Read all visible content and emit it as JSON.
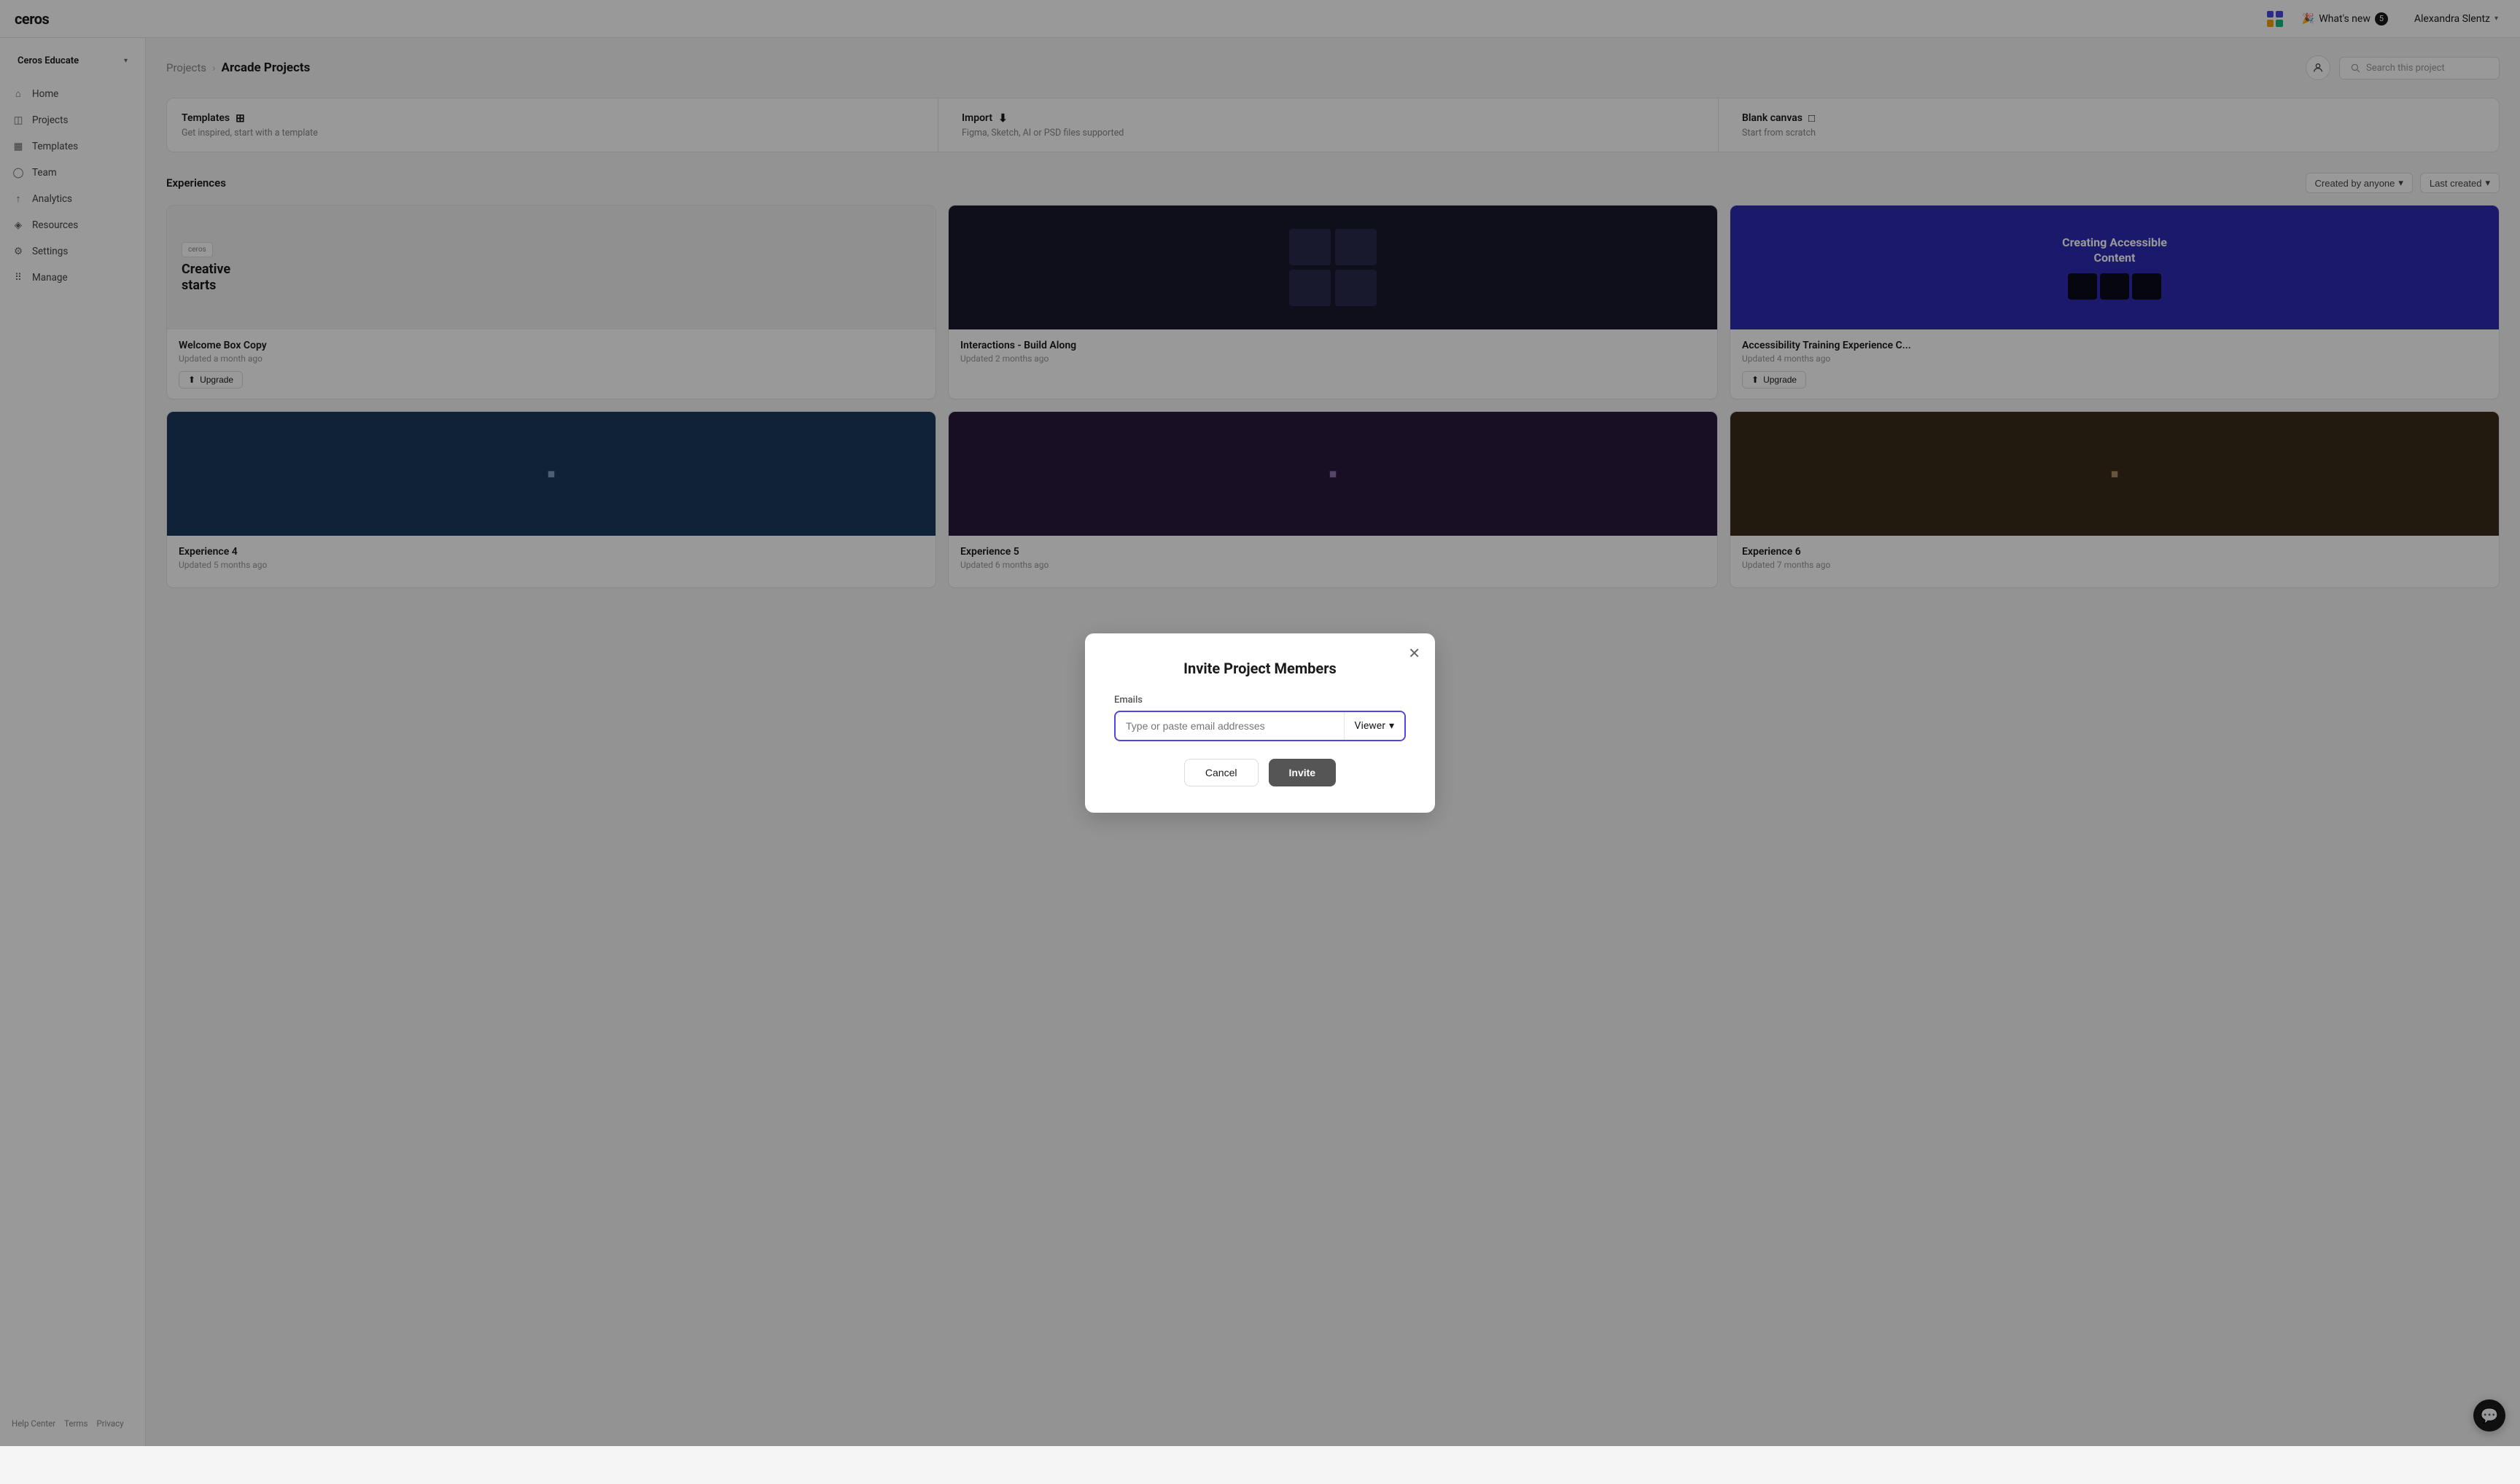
{
  "topbar": {
    "logo": "ceros",
    "whats_new_label": "What's new",
    "whats_new_badge": "5",
    "user_name": "Alexandra Slentz"
  },
  "sidebar": {
    "workspace": "Ceros Educate",
    "nav_items": [
      {
        "id": "home",
        "label": "Home",
        "icon": "home"
      },
      {
        "id": "projects",
        "label": "Projects",
        "icon": "folder"
      },
      {
        "id": "templates",
        "label": "Templates",
        "icon": "layout"
      },
      {
        "id": "team",
        "label": "Team",
        "icon": "user"
      },
      {
        "id": "analytics",
        "label": "Analytics",
        "icon": "bar-chart"
      },
      {
        "id": "resources",
        "label": "Resources",
        "icon": "bookmark"
      },
      {
        "id": "settings",
        "label": "Settings",
        "icon": "settings"
      },
      {
        "id": "manage",
        "label": "Manage",
        "icon": "users"
      }
    ],
    "footer": {
      "help": "Help Center",
      "terms": "Terms",
      "privacy": "Privacy"
    }
  },
  "header": {
    "breadcrumb_projects": "Projects",
    "breadcrumb_current": "Arcade Projects",
    "search_placeholder": "Search this project"
  },
  "quick_actions": [
    {
      "id": "templates",
      "title": "Templates",
      "description": "Get inspired, start with a template",
      "icon": "⊞"
    },
    {
      "id": "import",
      "title": "Import",
      "description": "Figma, Sketch, AI or PSD files supported",
      "icon": "⬇"
    },
    {
      "id": "blank",
      "title": "Blank canvas",
      "description": "Start from scratch",
      "icon": "□"
    }
  ],
  "experiences": {
    "section_title": "Experiences",
    "filter_creator": "Created by anyone",
    "filter_sort": "Last created"
  },
  "cards": [
    {
      "id": "welcome-box",
      "title": "Welcome Box Copy",
      "updated": "Updated a month ago",
      "thumb_text": "Creative starts",
      "thumb_style": "light",
      "has_upgrade": true
    },
    {
      "id": "interactions-build",
      "title": "Interactions - Build Along",
      "updated": "Updated 2 months ago",
      "thumb_style": "dark",
      "has_upgrade": false
    },
    {
      "id": "accessibility-training",
      "title": "Accessibility Training Experience C...",
      "updated": "Updated 4 months ago",
      "thumb_text": "Creating Accessible Content",
      "thumb_style": "blue",
      "has_upgrade": true
    },
    {
      "id": "card4",
      "title": "Experience 4",
      "updated": "Updated 5 months ago",
      "thumb_style": "dark2",
      "has_upgrade": false
    },
    {
      "id": "card5",
      "title": "Experience 5",
      "updated": "Updated 6 months ago",
      "thumb_style": "dark2",
      "has_upgrade": false
    },
    {
      "id": "card6",
      "title": "Experience 6",
      "updated": "Updated 7 months ago",
      "thumb_style": "dark2",
      "has_upgrade": false
    }
  ],
  "modal": {
    "title": "Invite Project Members",
    "email_label": "Emails",
    "email_placeholder": "Type or paste email addresses",
    "role_label": "Viewer",
    "cancel_label": "Cancel",
    "invite_label": "Invite"
  }
}
